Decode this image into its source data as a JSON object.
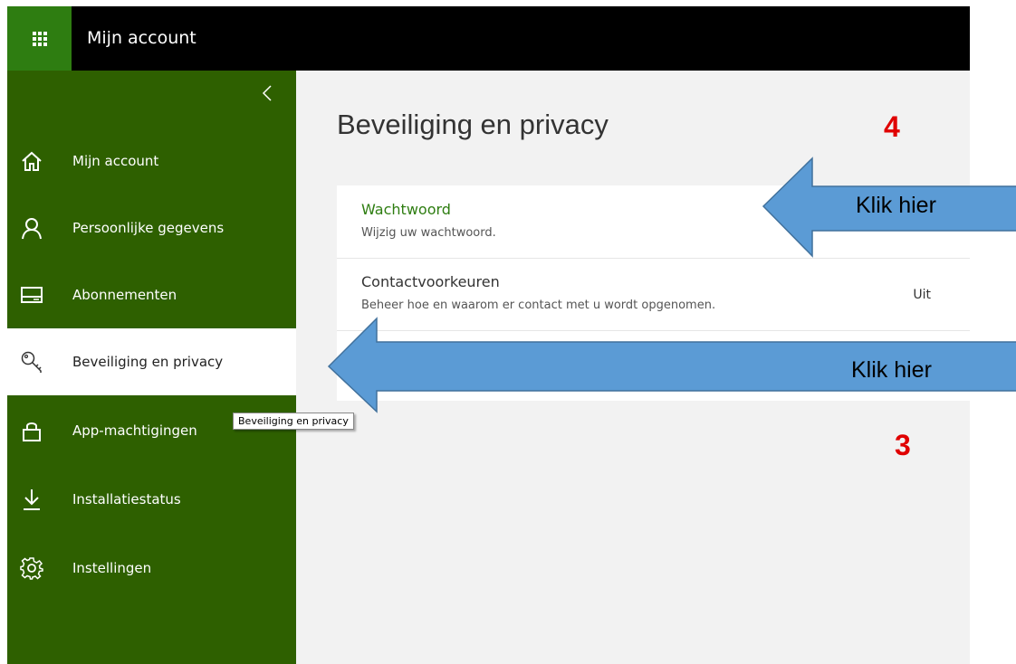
{
  "header": {
    "app_title": "Mijn account",
    "accent_color": "#2e7d11"
  },
  "sidebar": {
    "collapse_icon": "chevron-left-icon",
    "items": [
      {
        "label": "Mijn account",
        "icon": "home-icon",
        "active": false
      },
      {
        "label": "Persoonlijke gegevens",
        "icon": "person-icon",
        "active": false
      },
      {
        "label": "Abonnementen",
        "icon": "card-icon",
        "active": false
      },
      {
        "label": "Beveiliging en privacy",
        "icon": "key-icon",
        "active": true
      },
      {
        "label": "App-machtigingen",
        "icon": "lock-icon",
        "active": false
      },
      {
        "label": "Installatiestatus",
        "icon": "download-icon",
        "active": false
      },
      {
        "label": "Instellingen",
        "icon": "gear-icon",
        "active": false
      }
    ],
    "background_color": "#2e6000"
  },
  "tooltip": "Beveiliging en privacy",
  "main": {
    "title": "Beveiliging en privacy",
    "rows": [
      {
        "title": "Wachtwoord",
        "subtitle": "Wijzig uw wachtwoord.",
        "status": ""
      },
      {
        "title": "Contactvoorkeuren",
        "subtitle": "Beheer hoe en waarom er contact met u wordt opgenomen.",
        "status": "Uit"
      }
    ]
  },
  "annotations": {
    "step_top": "4",
    "step_bottom": "3",
    "arrow_top_label": "Klik hier",
    "arrow_bottom_label": "Klik hier",
    "arrow_color": "#5b9bd5",
    "number_color": "#e00000"
  }
}
